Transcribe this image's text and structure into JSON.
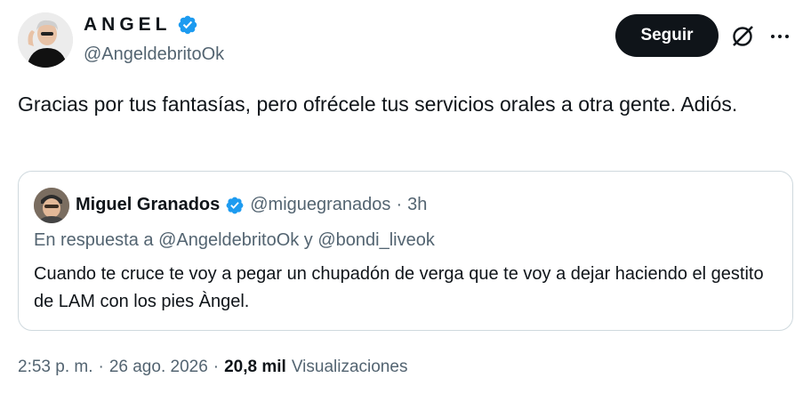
{
  "author": {
    "display_name": "ANGEL",
    "handle": "@AngeldebritoOk",
    "verified_icon": "verified-badge-icon"
  },
  "actions": {
    "follow_label": "Seguir",
    "grok_icon": "grok-icon",
    "more_icon": "more-options-icon"
  },
  "tweet": {
    "text": "Gracias por tus fantasías, pero ofrécele tus servicios orales a otra gente. Adiós."
  },
  "quote": {
    "name": "Miguel Granados",
    "handle": "@miguegranados",
    "separator": "·",
    "time": "3h",
    "reply_to": "En respuesta a @AngeldebritoOk y @bondi_liveok",
    "text": "Cuando te cruce te voy a pegar un chupadón de verga que te voy a dejar haciendo el gestito de LAM con los pies Àngel."
  },
  "meta": {
    "time": "2:53 p. m.",
    "sep1": "·",
    "date": "26 ago. 2026",
    "sep2": "·",
    "views_count": "20,8 mil",
    "views_label": "Visualizaciones"
  },
  "colors": {
    "text": "#0f1419",
    "secondary": "#536471",
    "verified": "#1d9bf0",
    "border": "#cfd9de",
    "button_bg": "#0f1419"
  }
}
